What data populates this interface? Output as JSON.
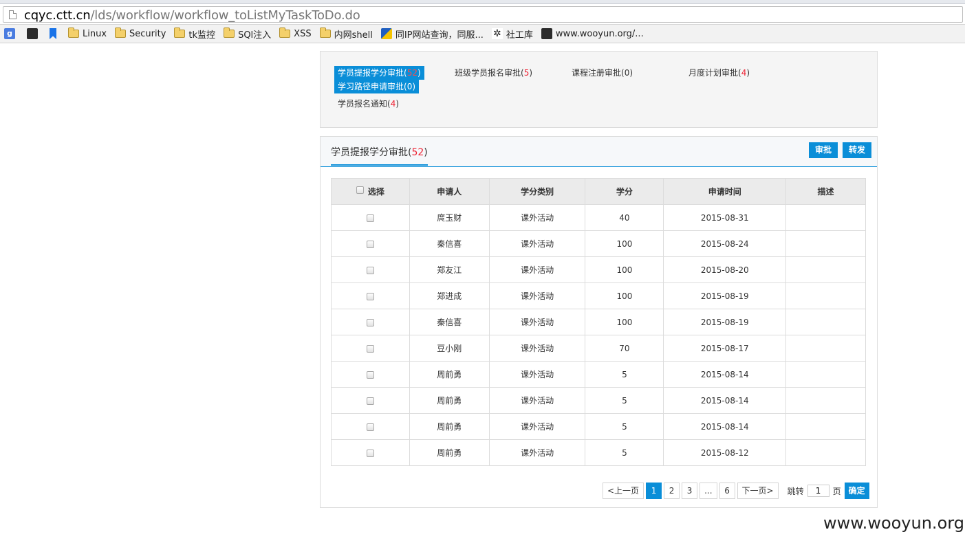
{
  "browser": {
    "url_host": "cqyc.ctt.cn",
    "url_path": "/lds/workflow/workflow_toListMyTaskToDo.do",
    "bookmarks": [
      {
        "label": "",
        "icon": "google-g-icon"
      },
      {
        "label": "",
        "icon": "dark-app-icon"
      },
      {
        "label": "",
        "icon": "bookmark-icon"
      },
      {
        "label": "Linux",
        "icon": "folder-icon"
      },
      {
        "label": "Security",
        "icon": "folder-icon"
      },
      {
        "label": "tk监控",
        "icon": "folder-icon"
      },
      {
        "label": "SQl注入",
        "icon": "folder-icon"
      },
      {
        "label": "XSS",
        "icon": "folder-icon"
      },
      {
        "label": "内网shell",
        "icon": "folder-icon"
      },
      {
        "label": "同IP网站查询，同服...",
        "icon": "ip-site-icon"
      },
      {
        "label": "社工库",
        "icon": "star-icon"
      },
      {
        "label": "www.wooyun.org/...",
        "icon": "dark-app-icon"
      }
    ]
  },
  "menu": {
    "items": [
      {
        "label": "学员提报学分审批(",
        "count": "52",
        "close": ")"
      },
      {
        "label": "班级学员报名审批(",
        "count": "5",
        "close": ")"
      },
      {
        "label": "课程注册审批(",
        "count": "0",
        "close": ")"
      },
      {
        "label": "月度计划审批(",
        "count": "4",
        "close": ")"
      },
      {
        "label": "学习路径申请审批(",
        "count": "0",
        "close": ")"
      },
      {
        "label": "学员报名通知(",
        "count": "4",
        "close": ")"
      }
    ]
  },
  "panel": {
    "title": "学员提报学分审批(",
    "count": "52",
    "close": ")",
    "approve_label": "审批",
    "forward_label": "转发"
  },
  "table": {
    "headers": [
      "选择",
      "申请人",
      "学分类别",
      "学分",
      "申请时间",
      "描述"
    ],
    "rows": [
      {
        "applicant": "庹玉财",
        "category": "课外活动",
        "credits": "40",
        "date": "2015-08-31",
        "desc": ""
      },
      {
        "applicant": "秦信喜",
        "category": "课外活动",
        "credits": "100",
        "date": "2015-08-24",
        "desc": ""
      },
      {
        "applicant": "郑友江",
        "category": "课外活动",
        "credits": "100",
        "date": "2015-08-20",
        "desc": ""
      },
      {
        "applicant": "郑进成",
        "category": "课外活动",
        "credits": "100",
        "date": "2015-08-19",
        "desc": ""
      },
      {
        "applicant": "秦信喜",
        "category": "课外活动",
        "credits": "100",
        "date": "2015-08-19",
        "desc": ""
      },
      {
        "applicant": "豆小刚",
        "category": "课外活动",
        "credits": "70",
        "date": "2015-08-17",
        "desc": ""
      },
      {
        "applicant": "周前勇",
        "category": "课外活动",
        "credits": "5",
        "date": "2015-08-14",
        "desc": ""
      },
      {
        "applicant": "周前勇",
        "category": "课外活动",
        "credits": "5",
        "date": "2015-08-14",
        "desc": ""
      },
      {
        "applicant": "周前勇",
        "category": "课外活动",
        "credits": "5",
        "date": "2015-08-14",
        "desc": ""
      },
      {
        "applicant": "周前勇",
        "category": "课外活动",
        "credits": "5",
        "date": "2015-08-12",
        "desc": ""
      }
    ]
  },
  "pager": {
    "prev": "<上一页",
    "pages": [
      "1",
      "2",
      "3",
      "...",
      "6"
    ],
    "current": "1",
    "next": "下一页>",
    "jump_label": "跳转",
    "jump_value": "1",
    "jump_suffix": "页",
    "ok_label": "确定"
  },
  "watermark": "www.wooyun.org",
  "colors": {
    "accent": "#0a8ed8",
    "count_red": "#e22233"
  }
}
